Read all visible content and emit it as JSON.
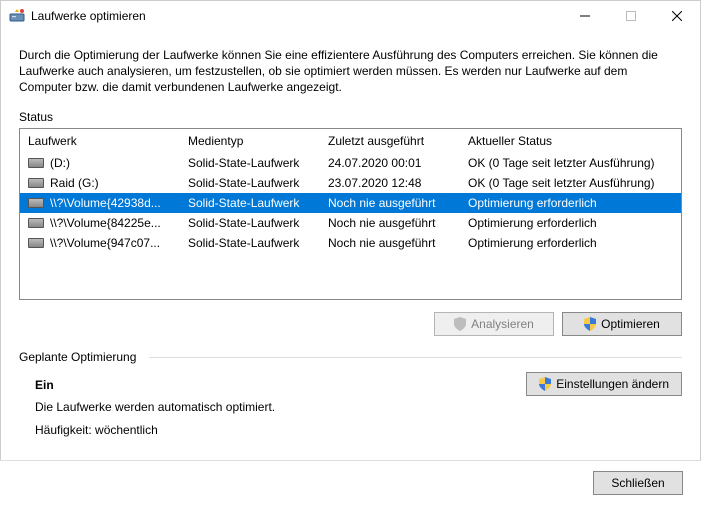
{
  "window": {
    "title": "Laufwerke optimieren"
  },
  "description": "Durch die Optimierung der Laufwerke können Sie eine effizientere Ausführung des Computers erreichen. Sie können die Laufwerke auch analysieren, um festzustellen, ob sie optimiert werden müssen. Es werden nur Laufwerke auf dem Computer bzw. die damit verbundenen Laufwerke angezeigt.",
  "statusLabel": "Status",
  "columns": {
    "drive": "Laufwerk",
    "media": "Medientyp",
    "last": "Zuletzt ausgeführt",
    "status": "Aktueller Status"
  },
  "rows": [
    {
      "drive": "(D:)",
      "media": "Solid-State-Laufwerk",
      "last": "24.07.2020 00:01",
      "status": "OK (0 Tage seit letzter Ausführung)",
      "selected": false
    },
    {
      "drive": "Raid (G:)",
      "media": "Solid-State-Laufwerk",
      "last": "23.07.2020 12:48",
      "status": "OK (0 Tage seit letzter Ausführung)",
      "selected": false
    },
    {
      "drive": "\\\\?\\Volume{42938d...",
      "media": "Solid-State-Laufwerk",
      "last": "Noch nie ausgeführt",
      "status": "Optimierung erforderlich",
      "selected": true
    },
    {
      "drive": "\\\\?\\Volume{84225e...",
      "media": "Solid-State-Laufwerk",
      "last": "Noch nie ausgeführt",
      "status": "Optimierung erforderlich",
      "selected": false
    },
    {
      "drive": "\\\\?\\Volume{947c07...",
      "media": "Solid-State-Laufwerk",
      "last": "Noch nie ausgeführt",
      "status": "Optimierung erforderlich",
      "selected": false
    }
  ],
  "buttons": {
    "analyze": "Analysieren",
    "optimize": "Optimieren",
    "settings": "Einstellungen ändern",
    "close": "Schließen"
  },
  "scheduled": {
    "heading": "Geplante Optimierung",
    "state": "Ein",
    "desc": "Die Laufwerke werden automatisch optimiert.",
    "freqLabel": "Häufigkeit:",
    "freqValue": "wöchentlich"
  }
}
